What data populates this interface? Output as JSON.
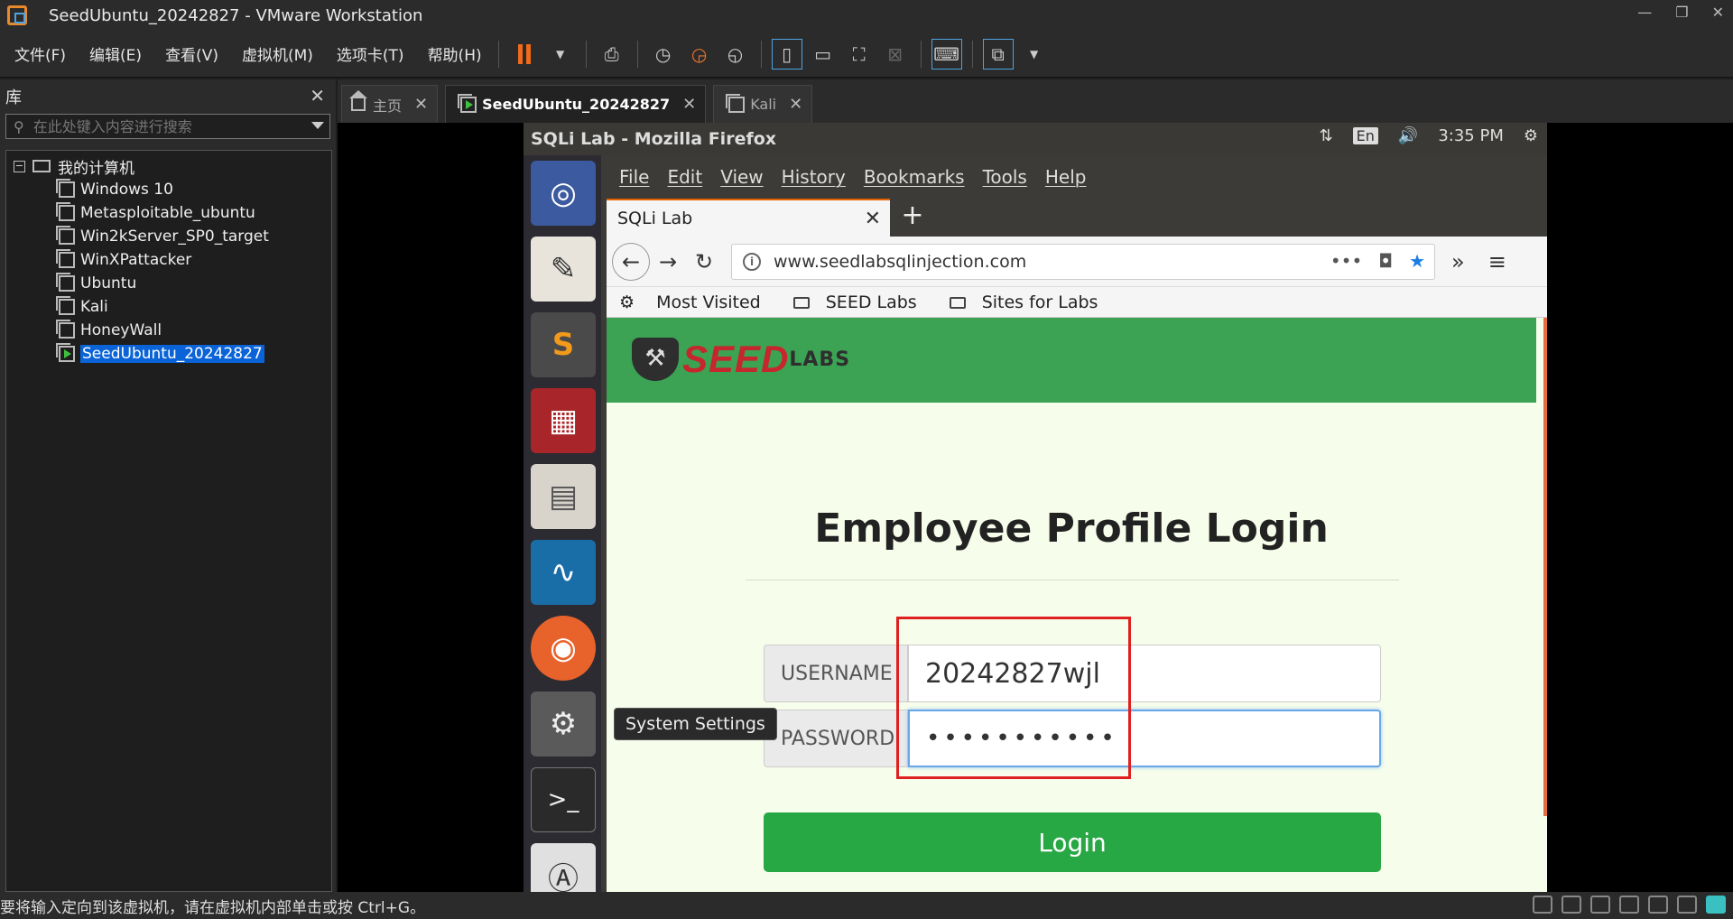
{
  "window": {
    "title": "SeedUbuntu_20242827 - VMware Workstation"
  },
  "menu": [
    "文件(F)",
    "编辑(E)",
    "查看(V)",
    "虚拟机(M)",
    "选项卡(T)",
    "帮助(H)"
  ],
  "library": {
    "title": "库",
    "search_placeholder": "在此处键入内容进行搜索",
    "root": "我的计算机",
    "items": [
      "Windows 10",
      "Metasploitable_ubuntu",
      "Win2kServer_SP0_target",
      "WinXPattacker",
      "Ubuntu",
      "Kali",
      "HoneyWall",
      "SeedUbuntu_20242827"
    ],
    "selected": "SeedUbuntu_20242827"
  },
  "tabs": [
    {
      "label": "主页"
    },
    {
      "label": "SeedUbuntu_20242827"
    },
    {
      "label": "Kali"
    }
  ],
  "ubuntu": {
    "window_title": "SQLi Lab - Mozilla Firefox",
    "lang": "En",
    "time": "3:35 PM",
    "tooltip": "System Settings"
  },
  "firefox": {
    "menu": [
      "File",
      "Edit",
      "View",
      "History",
      "Bookmarks",
      "Tools",
      "Help"
    ],
    "tab_title": "SQLi Lab",
    "url": "www.seedlabsqlinjection.com",
    "bookmarks": [
      "Most Visited",
      "SEED Labs",
      "Sites for Labs"
    ]
  },
  "page": {
    "logo_text": "SEED",
    "logo_sub": "LABS",
    "title": "Employee Profile Login",
    "username_label": "USERNAME",
    "username_value": "20242827wjl",
    "password_label": "PASSWORD",
    "password_value": "•••••••••••",
    "login_button": "Login"
  },
  "status": {
    "text": "要将输入定向到该虚拟机，请在虚拟机内部单击或按 Ctrl+G。"
  }
}
